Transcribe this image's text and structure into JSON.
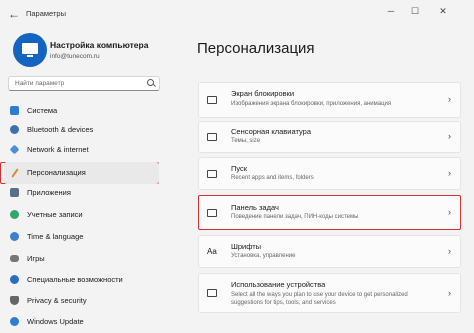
{
  "window": {
    "title": "Параметры"
  },
  "profile": {
    "name": "Настройка компьютера",
    "email": "info@tunecom.ru"
  },
  "search": {
    "placeholder": "Найти параметр"
  },
  "sidebar": {
    "items": [
      {
        "label": "Система",
        "icon": "system-icon",
        "color": "#2d7dd2"
      },
      {
        "label": "Bluetooth & devices",
        "icon": "bluetooth-icon",
        "color": "#3c6fb4"
      },
      {
        "label": "Network & internet",
        "icon": "network-icon",
        "color": "#4a8fd8"
      },
      {
        "label": "Персонализация",
        "icon": "brush-icon",
        "color": "#d98a36",
        "active": true
      },
      {
        "label": "Приложения",
        "icon": "apps-icon",
        "color": "#5a6e8a"
      },
      {
        "label": "Учетные записи",
        "icon": "accounts-icon",
        "color": "#2fa86a"
      },
      {
        "label": "Time & language",
        "icon": "time-language-icon",
        "color": "#3a82d0"
      },
      {
        "label": "Игры",
        "icon": "games-icon",
        "color": "#777777"
      },
      {
        "label": "Специальные возможности",
        "icon": "accessibility-icon",
        "color": "#2b6cc4"
      },
      {
        "label": "Privacy & security",
        "icon": "shield-icon",
        "color": "#666666"
      },
      {
        "label": "Windows Update",
        "icon": "update-icon",
        "color": "#2d7dd2"
      }
    ]
  },
  "main": {
    "title": "Персонализация",
    "cards": [
      {
        "title": "Экран блокировки",
        "subtitle": "Изображения экрана блокировки, приложения, анимация",
        "icon": "lock-screen-icon"
      },
      {
        "title": "Сенсорная клавиатура",
        "subtitle": "Темы, size",
        "icon": "keyboard-icon"
      },
      {
        "title": "Пуск",
        "subtitle": "Recent apps and items, folders",
        "icon": "start-icon"
      },
      {
        "title": "Панель задач",
        "subtitle": "Поведение панели задач, ПИН-коды системы",
        "icon": "taskbar-icon",
        "highlight": true
      },
      {
        "title": "Шрифты",
        "subtitle": "Установка, управление",
        "icon": "fonts-icon"
      },
      {
        "title": "Использование устройства",
        "subtitle": "Select all the ways you plan to use your device to get personalized suggestions for tips, tools, and services",
        "icon": "device-usage-icon"
      }
    ]
  }
}
